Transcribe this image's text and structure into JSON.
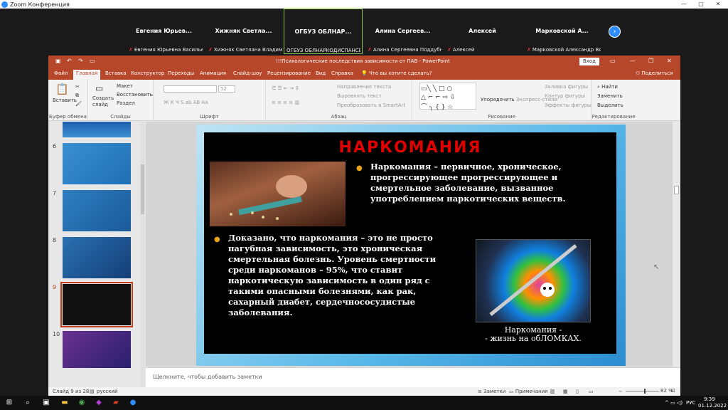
{
  "zoom": {
    "title": "Zoom Конференция",
    "controls": [
      "—",
      "▢",
      "✕"
    ],
    "participants": [
      {
        "name": "Евгения  Юрьев...",
        "label": "Евгения Юрьевна Васильева",
        "muted": true
      },
      {
        "name": "Хижняк  Светла...",
        "label": "Хижняк Светлана Владимиро...",
        "muted": true
      },
      {
        "name": "ОГБУЗ  ОБЛНАР...",
        "label": "ОГБУЗ ОБЛНАРКОДИСПАНСЕР",
        "muted": false,
        "active": true
      },
      {
        "name": "Алина  Сергеев...",
        "label": "Алина Сергеевна Поддубная",
        "muted": true
      },
      {
        "name": "Алексей",
        "label": "Алексей",
        "muted": true
      },
      {
        "name": "Марковской  А...",
        "label": "Марковской Александр Вяче...",
        "muted": true
      }
    ],
    "next_icon": "chevron-right-icon"
  },
  "powerpoint": {
    "window_title": "!!!Психологические последствия зависимости от ПАВ  -  PowerPoint",
    "signin": "Вход",
    "tabs": [
      "Файл",
      "Главная",
      "Вставка",
      "Конструктор",
      "Переходы",
      "Анимация",
      "Слайд-шоу",
      "Рецензирование",
      "Вид",
      "Справка"
    ],
    "active_tab": "Главная",
    "tell_me": "Что вы хотите сделать?",
    "share": "Поделиться",
    "ribbon": {
      "paste": "Вставить",
      "clipboard": "Буфер обмена",
      "new_slide": "Создать слайд",
      "layout": "Макет",
      "reset": "Восстановить",
      "section": "Раздел",
      "slides": "Слайды",
      "font_size": "52",
      "font_group": "Шрифт",
      "text_direction": "Направление текста",
      "align_text": "Выровнять текст",
      "smartart": "Преобразовать в SmartArt",
      "paragraph": "Абзац",
      "arrange": "Упорядочить",
      "quick_styles": "Экспресс-стили",
      "shape_fill": "Заливка фигуры",
      "shape_outline": "Контур фигуры",
      "shape_effects": "Эффекты фигуры",
      "drawing": "Рисование",
      "find": "Найти",
      "replace": "Заменить",
      "select": "Выделить",
      "editing": "Редактирование"
    },
    "thumbnails": [
      {
        "num": "6",
        "selected": false
      },
      {
        "num": "7",
        "selected": false
      },
      {
        "num": "8",
        "selected": false
      },
      {
        "num": "9",
        "selected": true
      },
      {
        "num": "10",
        "selected": false
      }
    ],
    "slide": {
      "title": "НАРКОМАНИЯ",
      "bullet1": "Наркомания – первичное, хроническое, прогрессирующее прогрессирующее и смертельное заболевание, вызванное употреблением наркотических веществ.",
      "bullet2": "Доказано, что наркомания – это не просто пагубная зависимость, это хроническая смертельная болезнь. Уровень смертности среди наркоманов – 95%, что ставит наркотическую зависимость в один ряд с такими опасными болезнями, как рак, сахарный диабет, сердечнососудистые заболевания.",
      "caption": "Наркомания -\n- жизнь на обЛОМКАХ."
    },
    "notes_placeholder": "Щелкните, чтобы добавить заметки",
    "status": {
      "slide_info": "Слайд 9 из 28",
      "language": "русский",
      "notes": "Заметки",
      "comments": "Примечания",
      "zoom": "82 %",
      "zoom_value": 82
    }
  },
  "taskbar": {
    "lang": "РУС",
    "time": "9:39",
    "date": "01.12.2022"
  },
  "colors": {
    "ppt_accent": "#b7472a",
    "zoom_blue": "#2d8cff",
    "title_red": "#e00000",
    "bullet_gold": "#e8a317"
  }
}
